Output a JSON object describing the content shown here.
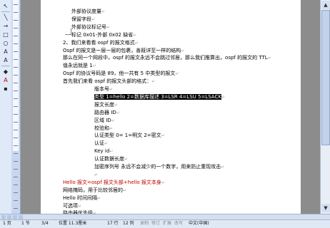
{
  "document": {
    "lines": [
      {
        "id": "l1",
        "text": "外部协议度量",
        "indent": 1
      },
      {
        "id": "l2",
        "text": "保留字段",
        "indent": 1
      },
      {
        "id": "l3",
        "text": "外部协议标记号",
        "indent": 1
      },
      {
        "id": "l4",
        "text": "标记 0x01-外部 0x02 缺省",
        "indent": 1
      },
      {
        "id": "l5",
        "text": "2、我们来看看 ospf 的报文格式",
        "indent": 0
      },
      {
        "id": "l6",
        "text": "Ospf 的报文是一层一层的包裹，善既详至一样的结构",
        "indent": 0
      },
      {
        "id": "l7",
        "text": "那么在同一个网段中，ospf 的报文永远不会跳过邻居，那么我们推算出，ospf 的报文的 TTL",
        "indent": 0
      },
      {
        "id": "l8",
        "text": "值永远就是 1",
        "indent": 0
      },
      {
        "id": "l9",
        "text": "Ospf 的协议号码是 89，他一共有 5 中类型的报文",
        "indent": 0
      },
      {
        "id": "l10",
        "text": "首先我们来看 ospf 的报文头部的格式：",
        "indent": 0
      },
      {
        "id": "l11",
        "text": "版本号",
        "indent": 2
      },
      {
        "id": "l12",
        "text": "类型  1=hello 2=数据库描述  3=LSR 4=LSU 5=LSACK",
        "indent": 2,
        "highlight": true
      },
      {
        "id": "l13",
        "text": "报文长度",
        "indent": 2
      },
      {
        "id": "l14",
        "text": "路由器 ID",
        "indent": 2
      },
      {
        "id": "l15",
        "text": "区域 ID",
        "indent": 2
      },
      {
        "id": "l16",
        "text": "校验和",
        "indent": 2
      },
      {
        "id": "l17",
        "text": "认证类型 0= 1=明文 2=密文",
        "indent": 2
      },
      {
        "id": "l18",
        "text": "认证",
        "indent": 2
      },
      {
        "id": "l19",
        "text": "Key id",
        "indent": 2
      },
      {
        "id": "l20",
        "text": "认证数据长度",
        "indent": 2
      },
      {
        "id": "l21",
        "text": "加密序列号 永远不会减少的一个数字，用来防止重现攻击",
        "indent": 2
      },
      {
        "id": "l22",
        "text": "",
        "indent": 2
      },
      {
        "id": "l23",
        "text": "Hello 报文=ospf 报文头部+hello 报文本身",
        "indent": 0,
        "red": true
      },
      {
        "id": "l24",
        "text": "网络掩码，用于比较邻居的",
        "indent": 0
      },
      {
        "id": "l25",
        "text": "Hello 时间间隔",
        "indent": 0
      },
      {
        "id": "l26",
        "text": "可选项",
        "indent": 0
      },
      {
        "id": "l27",
        "text": "路由器优先级",
        "indent": 0
      }
    ]
  },
  "statusbar": {
    "page": "1 页",
    "section": "1 节",
    "page_of": "3/4",
    "position": "位置 11.3厘米",
    "line": "17 行",
    "column": "12 列",
    "rec": "录制",
    "trk": "修订",
    "ext": "扩展",
    "ovr": "改写",
    "language": "中文(中国)"
  },
  "icons": {
    "scroll_up": "▲",
    "scroll_down": "▼",
    "select": "↖",
    "line_tool": "╲",
    "arrow_tool": "→",
    "rect_tool": "□",
    "oval_tool": "○",
    "textbox_tool": "A",
    "wordart_tool": "A",
    "fill_tool": "◆",
    "font_color_tool": "A",
    "shadow_tool": "▪"
  }
}
